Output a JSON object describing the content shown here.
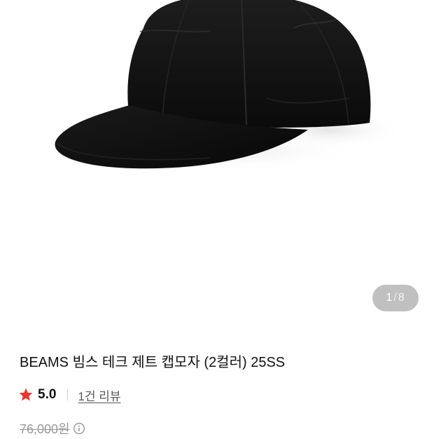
{
  "gallery": {
    "current_index": "1",
    "separator": "/",
    "total_count": "8"
  },
  "product": {
    "title": "BEAMS 빔스 테크 제트 캡모자 (2컬러) 25SS",
    "rating_value": "5.0",
    "review_link_label": "1건 리뷰",
    "original_price": "76,000원"
  },
  "icons": {
    "rating": "star-icon",
    "price_info": "info-icon"
  },
  "colors": {
    "star": "#e8352c",
    "text": "#111111",
    "muted": "#999999",
    "link": "#555555"
  }
}
